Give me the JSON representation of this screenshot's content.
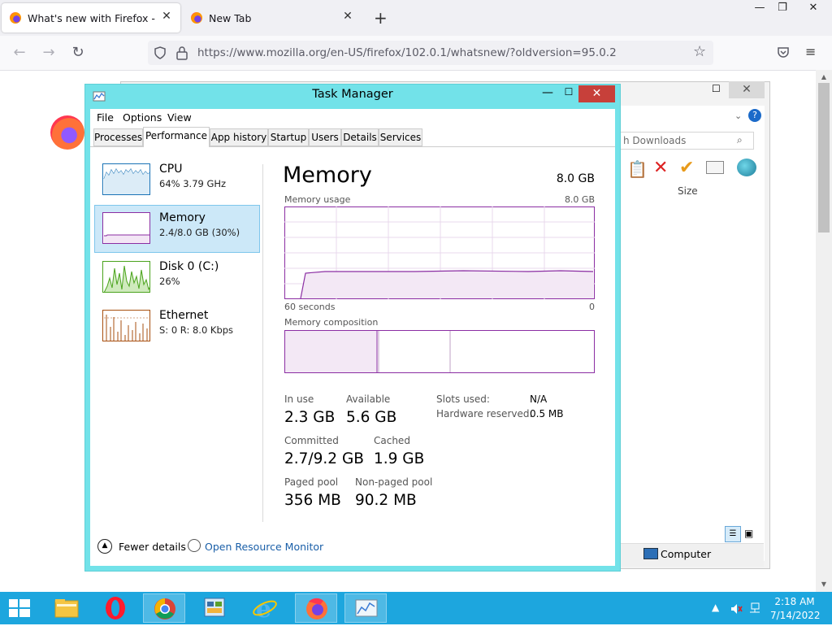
{
  "browser": {
    "tabs": [
      {
        "label": "What's new with Firefox - More",
        "active": true
      },
      {
        "label": "New Tab",
        "active": false
      }
    ],
    "new_tab_glyph": "+",
    "url": "https://www.mozilla.org/en-US/firefox/102.0.1/whatsnew/?oldversion=95.0.2",
    "window_controls": {
      "minimize": "—",
      "maximize": "❐",
      "close": "✕"
    }
  },
  "explorer": {
    "search_placeholder": "h Downloads",
    "column_size": "Size",
    "status_item": "Computer",
    "close_glyph": "✕"
  },
  "task_manager": {
    "title": "Task Manager",
    "menu": [
      "File",
      "Options",
      "View"
    ],
    "tabs": [
      "Processes",
      "Performance",
      "App history",
      "Startup",
      "Users",
      "Details",
      "Services"
    ],
    "active_tab": "Performance",
    "resources": [
      {
        "name": "CPU",
        "value": "64%  3.79 GHz",
        "color": "#1a73b6"
      },
      {
        "name": "Memory",
        "value": "2.4/8.0 GB (30%)",
        "color": "#8b2ea3",
        "selected": true
      },
      {
        "name": "Disk 0 (C:)",
        "value": "26%",
        "color": "#4aa31c"
      },
      {
        "name": "Ethernet",
        "value": "S: 0  R: 8.0 Kbps",
        "color": "#a74f0f"
      }
    ],
    "detail": {
      "heading": "Memory",
      "total": "8.0 GB",
      "usage_label": "Memory usage",
      "usage_max": "8.0 GB",
      "axis_left": "60 seconds",
      "axis_right": "0",
      "composition_label": "Memory composition",
      "in_use_label": "In use",
      "in_use": "2.3 GB",
      "available_label": "Available",
      "available": "5.6 GB",
      "slots_label": "Slots used:",
      "slots": "N/A",
      "hw_reserved_label": "Hardware reserved:",
      "hw_reserved": "0.5 MB",
      "committed_label": "Committed",
      "committed": "2.7/9.2 GB",
      "cached_label": "Cached",
      "cached": "1.9 GB",
      "paged_label": "Paged pool",
      "paged": "356 MB",
      "nonpaged_label": "Non-paged pool",
      "nonpaged": "90.2 MB"
    },
    "footer": {
      "fewer_details": "Fewer details",
      "open_resource_monitor": "Open Resource Monitor"
    },
    "close_glyph": "✕"
  },
  "taskbar": {
    "time": "2:18 AM",
    "date": "7/14/2022",
    "accent": "#1da6de"
  }
}
